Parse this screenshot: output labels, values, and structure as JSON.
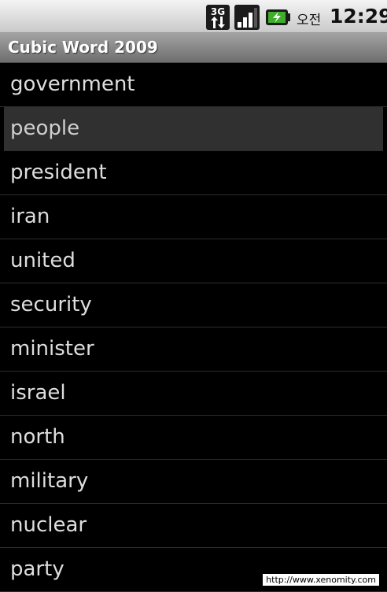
{
  "status_bar": {
    "network_type": "3G",
    "ampm": "오전",
    "time": "12:29",
    "icons": [
      "3g-data-icon",
      "signal-strength-icon",
      "battery-charging-icon"
    ]
  },
  "app": {
    "title": "Cubic Word 2009"
  },
  "words": [
    {
      "label": "government",
      "selected": false
    },
    {
      "label": "people",
      "selected": true
    },
    {
      "label": "president",
      "selected": false
    },
    {
      "label": "iran",
      "selected": false
    },
    {
      "label": "united",
      "selected": false
    },
    {
      "label": "security",
      "selected": false
    },
    {
      "label": "minister",
      "selected": false
    },
    {
      "label": "israel",
      "selected": false
    },
    {
      "label": "north",
      "selected": false
    },
    {
      "label": "military",
      "selected": false
    },
    {
      "label": "nuclear",
      "selected": false
    },
    {
      "label": "party",
      "selected": false
    }
  ],
  "watermark": "http://www.xenomity.com",
  "colors": {
    "selected_row": "#303030",
    "battery_accent": "#3fae2a"
  }
}
